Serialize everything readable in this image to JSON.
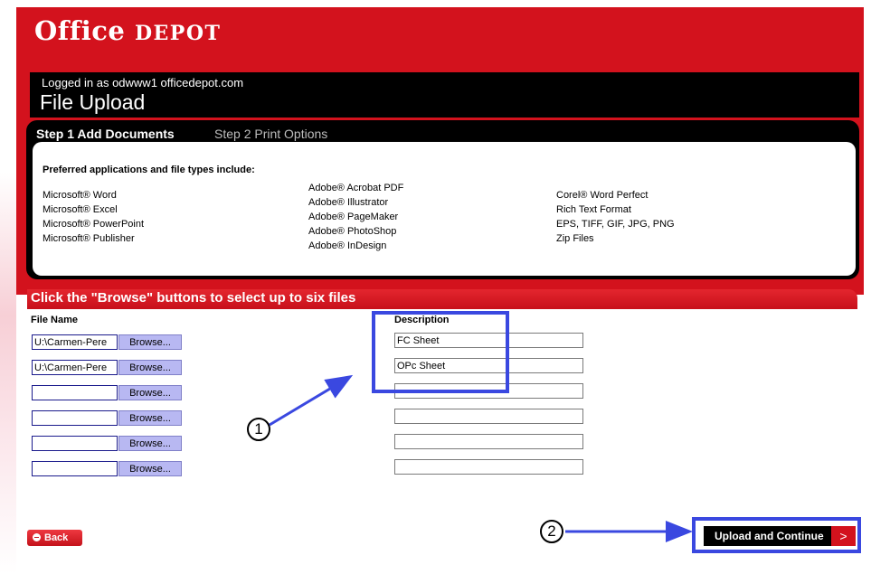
{
  "brand": {
    "logo_primary": "Office",
    "logo_secondary": "DEPOT",
    "red": "#d3121d",
    "highlight_blue": "#3a48e0"
  },
  "header": {
    "logged_in": "Logged in as odwww1 officedepot.com",
    "title": "File Upload"
  },
  "steps": {
    "step1": "Step 1 Add Documents",
    "step2": "Step 2 Print Options"
  },
  "preferred": {
    "heading": "Preferred applications and file types include:",
    "col1": [
      "Microsoft® Word",
      "Microsoft® Excel",
      "Microsoft® PowerPoint",
      "Microsoft® Publisher"
    ],
    "col2": [
      "Adobe® Acrobat PDF",
      "Adobe® Illustrator",
      "Adobe® PageMaker",
      "Adobe® PhotoShop",
      "Adobe® InDesign"
    ],
    "col3": [
      "Corel® Word Perfect",
      "Rich Text Format",
      "EPS, TIFF, GIF, JPG, PNG",
      "Zip Files"
    ]
  },
  "upload": {
    "banner": "Click the \"Browse\" buttons to select up to six files",
    "file_name_header": "File Name",
    "description_header": "Description",
    "browse_label": "Browse...",
    "rows": [
      {
        "file": "U:\\Carmen-Pere",
        "description": "FC Sheet"
      },
      {
        "file": "U:\\Carmen-Pere",
        "description": "OPc Sheet"
      },
      {
        "file": "",
        "description": ""
      },
      {
        "file": "",
        "description": ""
      },
      {
        "file": "",
        "description": ""
      },
      {
        "file": "",
        "description": ""
      }
    ]
  },
  "actions": {
    "back_label": "Back",
    "upload_label": "Upload and Continue",
    "upload_arrow": ">"
  },
  "callouts": {
    "one": "1",
    "two": "2"
  }
}
